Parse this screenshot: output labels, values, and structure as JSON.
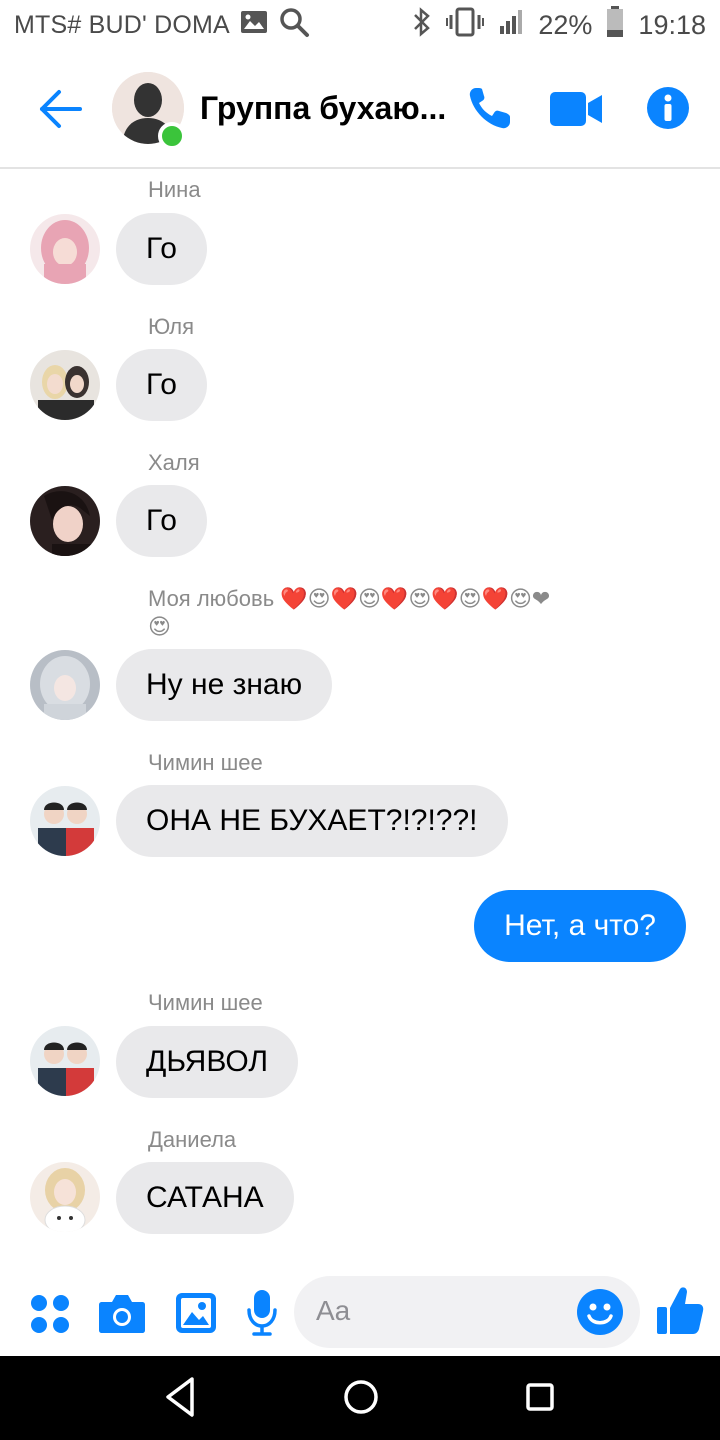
{
  "status_bar": {
    "carrier": "MTS# BUD' DOMA",
    "battery": "22%",
    "time": "19:18"
  },
  "header": {
    "title": "Группа бухаю...",
    "icons": [
      "back-arrow-icon",
      "phone-icon",
      "video-camera-icon",
      "info-icon"
    ]
  },
  "messages": [
    {
      "sender": "Нина",
      "text": "Го",
      "direction": "in"
    },
    {
      "sender": "Юля",
      "text": "Го",
      "direction": "in"
    },
    {
      "sender": "Халя",
      "text": "Го",
      "direction": "in"
    },
    {
      "sender": "Моя любовь ❤️😍❤️😍❤️😍❤️😍❤️😍❤",
      "sender_line2": "😍",
      "text": "Ну не знаю",
      "direction": "in"
    },
    {
      "sender": "Чимин шее",
      "text": "ОНА НЕ БУХАЕТ?!?!??!",
      "direction": "in"
    },
    {
      "sender": "",
      "text": "Нет, а что?",
      "direction": "out"
    },
    {
      "sender": "Чимин шее",
      "text": "ДЬЯВОЛ",
      "direction": "in"
    },
    {
      "sender": "Даниела",
      "text": "САТАНА",
      "direction": "in"
    }
  ],
  "composer": {
    "placeholder": "Aa",
    "icons": [
      "apps-grid-icon",
      "camera-icon",
      "gallery-icon",
      "microphone-icon",
      "emoji-icon",
      "thumbs-up-icon"
    ]
  },
  "colors": {
    "accent": "#0a84ff",
    "incoming_bubble": "#e9e9eb",
    "online": "#3bc43b"
  }
}
